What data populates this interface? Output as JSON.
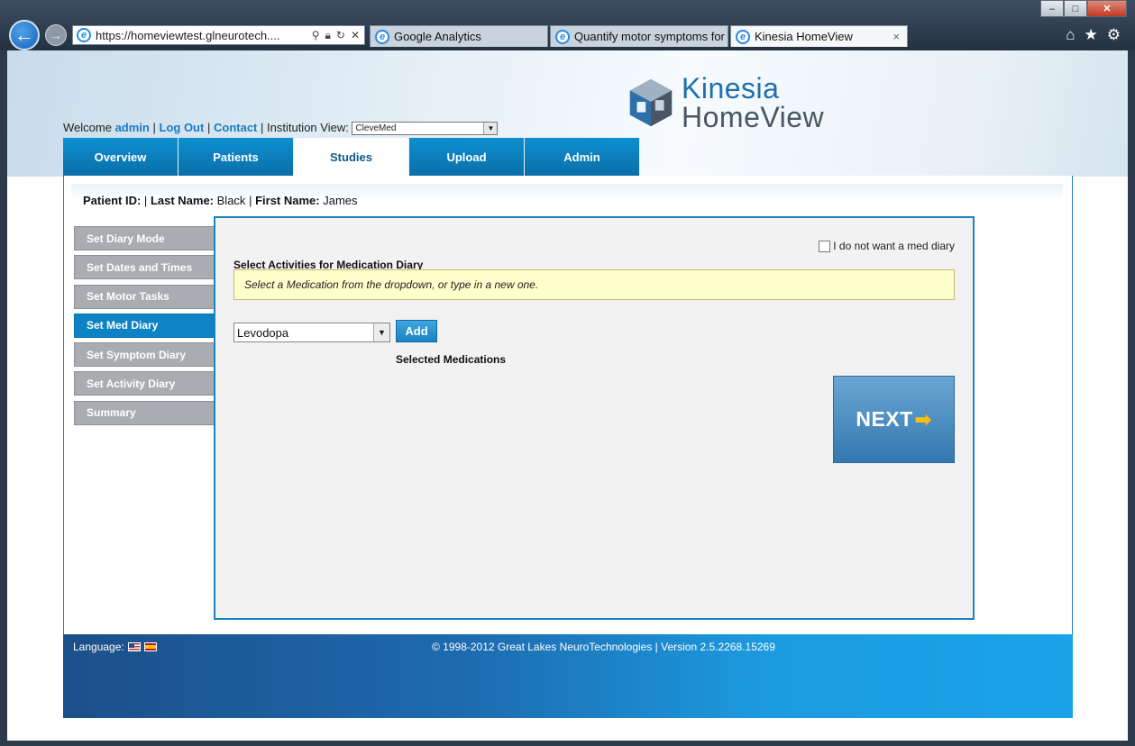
{
  "browser": {
    "address_url": "https://homeviewtest.glneurotech....",
    "tabs": [
      {
        "label": "Google Analytics"
      },
      {
        "label": "Quantify motor symptoms for ..."
      },
      {
        "label": "Kinesia HomeView",
        "close": "×"
      }
    ],
    "window_buttons": {
      "minimize": "–",
      "maximize": "□",
      "close": "✕"
    }
  },
  "logo": {
    "line1": "Kinesia",
    "line2": "HomeView"
  },
  "welcome": {
    "prefix": "Welcome",
    "user": "admin",
    "sep1": "|",
    "logout": "Log Out",
    "sep2": "|",
    "contact": "Contact",
    "sep3": "|",
    "institution_label": "Institution View:",
    "institution_value": "CleveMed"
  },
  "main_tabs": [
    {
      "label": "Overview"
    },
    {
      "label": "Patients"
    },
    {
      "label": "Studies",
      "active": true
    },
    {
      "label": "Upload"
    },
    {
      "label": "Admin"
    }
  ],
  "patient": {
    "id_label": "Patient ID:",
    "last_name_label": "Last Name:",
    "last_name": "Black",
    "first_name_label": "First Name:",
    "first_name": "James"
  },
  "side_nav": [
    {
      "label": "Set Diary Mode"
    },
    {
      "label": "Set Dates and Times"
    },
    {
      "label": "Set Motor Tasks"
    },
    {
      "label": "Set Med Diary",
      "active": true
    },
    {
      "label": "Set Symptom Diary"
    },
    {
      "label": "Set Activity Diary"
    },
    {
      "label": "Summary"
    }
  ],
  "panel": {
    "no_diary_label": "I do not want a med diary",
    "title": "Select Activities for Medication Diary",
    "hint": "Select a Medication from the dropdown, or type in a new one.",
    "medication_value": "Levodopa",
    "add_label": "Add",
    "selected_label": "Selected Medications",
    "next_label": "NEXT"
  },
  "footer": {
    "language_label": "Language:",
    "copyright": "© 1998-2012 Great Lakes NeuroTechnologies | Version 2.5.2268.15269"
  },
  "colors": {
    "accent": "#0d83c6",
    "side_inactive": "#a9adb1",
    "hint_bg": "#ffffcc",
    "next_arrow": "#f3c012"
  }
}
